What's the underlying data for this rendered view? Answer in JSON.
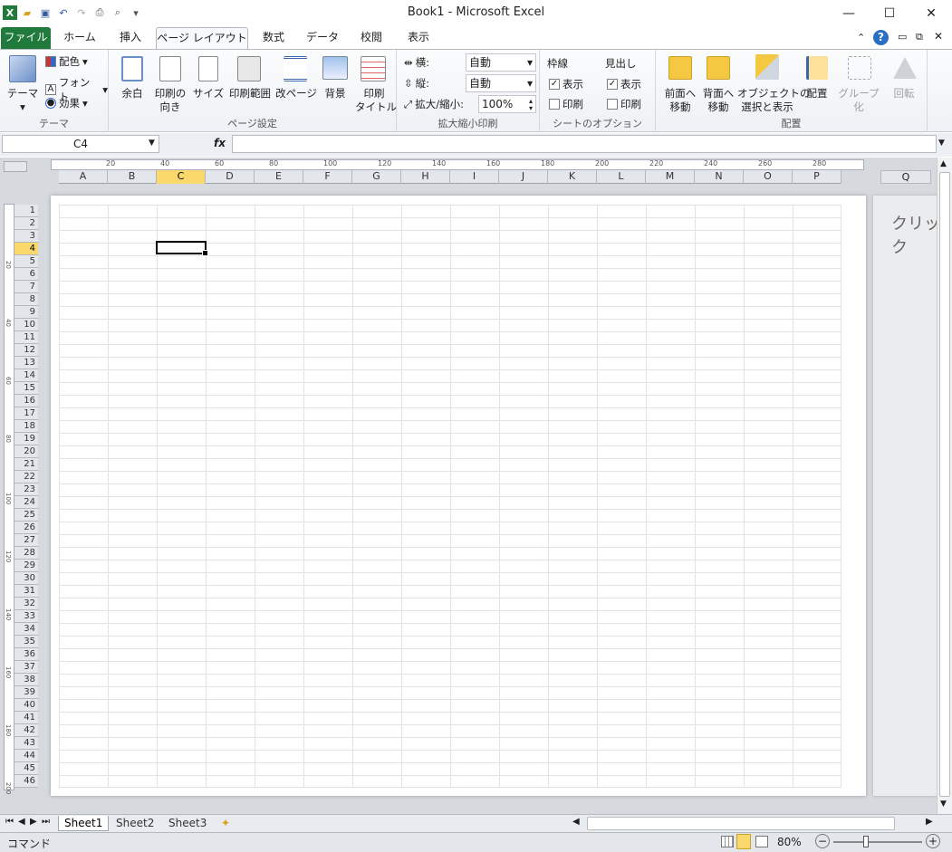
{
  "app": {
    "title": "Book1 - Microsoft Excel"
  },
  "qat": {
    "items": [
      "excel-icon",
      "open-icon",
      "save-icon",
      "undo-icon",
      "redo-icon",
      "print-icon",
      "preview-icon",
      "customize-icon"
    ]
  },
  "window": {
    "minimize": "—",
    "maximize": "☐",
    "close": "✕"
  },
  "tabs": [
    "ファイル",
    "ホーム",
    "挿入",
    "ページ レイアウト",
    "数式",
    "データ",
    "校閲",
    "表示"
  ],
  "ribbon": {
    "theme": {
      "label": "テーマ",
      "big": "テーマ",
      "colors": "配色",
      "fonts": "フォント",
      "effects": "効果"
    },
    "pagesetup": {
      "label": "ページ設定",
      "margins": "余白",
      "orientation": "印刷の\n向き",
      "size": "サイズ",
      "printarea": "印刷範囲",
      "breaks": "改ページ",
      "background": "背景",
      "titles": "印刷\nタイトル"
    },
    "scale": {
      "label": "拡大縮小印刷",
      "width_label": "横:",
      "width_value": "自動",
      "height_label": "縦:",
      "height_value": "自動",
      "scale_label": "拡大/縮小:",
      "scale_value": "100%"
    },
    "sheetopts": {
      "label": "シートのオプション",
      "gridlines": "枠線",
      "headings": "見出し",
      "view": "表示",
      "print": "印刷"
    },
    "arrange": {
      "label": "配置",
      "forward": "前面へ\n移動",
      "backward": "背面へ\n移動",
      "selection": "オブジェクトの\n選択と表示",
      "align": "配置",
      "group": "グループ化",
      "rotate": "回転"
    }
  },
  "formula": {
    "namebox": "C4",
    "fx": "fx",
    "value": ""
  },
  "columns": [
    "A",
    "B",
    "C",
    "D",
    "E",
    "F",
    "G",
    "H",
    "I",
    "J",
    "K",
    "L",
    "M",
    "N",
    "O",
    "P"
  ],
  "selected_col": "C",
  "selected_row": "4",
  "next_col": "Q",
  "ruler_h": [
    "20",
    "40",
    "60",
    "80",
    "100",
    "120",
    "140",
    "160",
    "180",
    "200",
    "220",
    "240",
    "260",
    "280"
  ],
  "ruler_v": [
    "20",
    "40",
    "60",
    "80",
    "100",
    "120",
    "140",
    "160",
    "180",
    "200"
  ],
  "page2_text": "クリック",
  "sheets": [
    "Sheet1",
    "Sheet2",
    "Sheet3"
  ],
  "status": {
    "mode": "コマンド",
    "zoom": "80%"
  }
}
